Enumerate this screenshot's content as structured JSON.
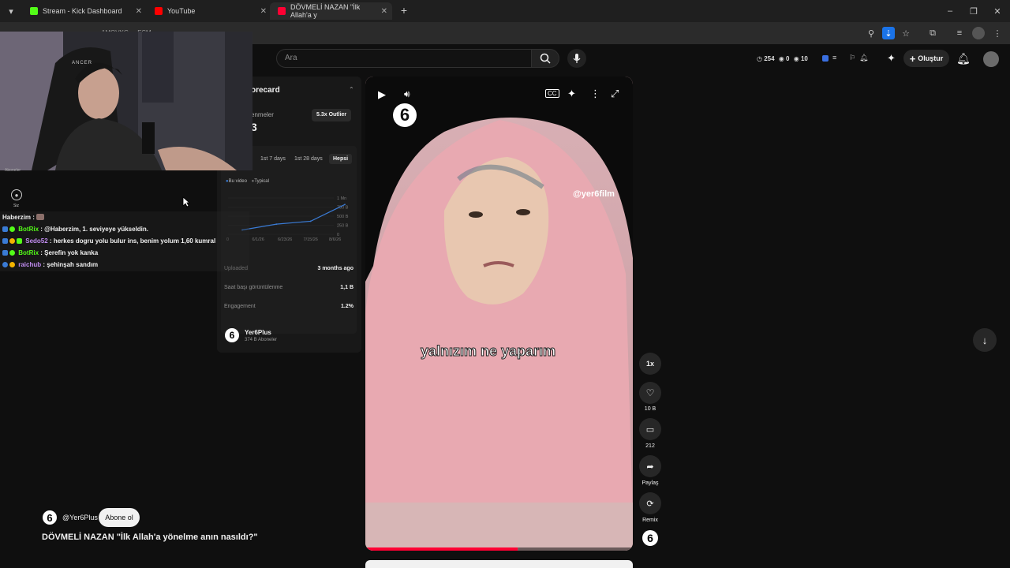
{
  "browser": {
    "tabs": [
      {
        "title": "Stream - Kick Dashboard",
        "favicon_color": "#53fc18"
      },
      {
        "title": "YouTube",
        "favicon_color": "#ff0000"
      },
      {
        "title": "DÖVMELİ NAZAN \"İlk Allah'a y",
        "favicon_color": "#ff0033"
      }
    ],
    "new_tab": "+",
    "address_fragment": "... 1MOVKG ... ESM"
  },
  "youtube": {
    "search_placeholder": "Ara",
    "stats": {
      "time": "254",
      "views": "0",
      "eyes": "10"
    },
    "create_label": "Oluştur"
  },
  "webcam": {
    "caption": "Aboneler",
    "you_label": "Siz",
    "chair_brand": "ANCER"
  },
  "chat": {
    "messages": [
      {
        "user": "Haberzim",
        "text": "",
        "color": "#f1f1f1",
        "badges": []
      },
      {
        "user": "BotRix",
        "text": "@Haberzim, 1. seviyeye yükseldin.",
        "color": "#53fc18",
        "badges": [
          "#3a7bd5",
          "#53fc18"
        ]
      },
      {
        "user": "Sedo52",
        "text": "herkes dogru yolu bulur ins, benim yolum 1,60 kumral",
        "color": "#c08cf0",
        "badges": [
          "#3a7bd5",
          "#f4b400",
          "#53fc18"
        ]
      },
      {
        "user": "BotRix",
        "text": "Şerefin yok kanka",
        "color": "#53fc18",
        "badges": [
          "#3a7bd5",
          "#53fc18"
        ]
      },
      {
        "user": "raichub",
        "text": "şehinşah sandım",
        "color": "#c08cf0",
        "badges": [
          "#3a7bd5",
          "#f4b400"
        ]
      }
    ]
  },
  "panel": {
    "title_fragment": "orecard",
    "views_label_fragment": "enmeler",
    "views_value_fragment": "3",
    "outlier_badge": "5.3x Outlier",
    "ranges": [
      "1st 7 days",
      "1st 28 days",
      "Hepsi"
    ],
    "legend": [
      "Bu video",
      "Typical"
    ],
    "y_ticks": [
      "1 Mn",
      "750 B",
      "500 B",
      "250 B",
      "0"
    ],
    "x_ticks": [
      "0",
      "6/1/26",
      "6/23/26",
      "7/15/26",
      "8/6/26"
    ],
    "rows": [
      {
        "label": "Uploaded",
        "value": "3 months ago"
      },
      {
        "label": "Saat başı görüntülenme",
        "value": "1,1 B"
      },
      {
        "label": "Engagement",
        "value": "1.2%"
      }
    ],
    "channel_name": "Yer6Plus",
    "channel_subs": "374 B Aboneler"
  },
  "chart_data": {
    "type": "line",
    "x": [
      "6/1/26",
      "6/23/26",
      "7/15/26",
      "8/6/26"
    ],
    "series": [
      {
        "name": "Bu video",
        "values": [
          120000,
          280000,
          360000,
          820000
        ]
      }
    ],
    "ylim": [
      0,
      1000000
    ],
    "y_ticks": [
      "1 Mn",
      "750 B",
      "500 B",
      "250 B",
      "0"
    ],
    "legend_position": "top-left"
  },
  "video": {
    "watermark": "@yer6film",
    "subtitle": "yalnızım ne yaparım",
    "logo": "6",
    "progress": 0.57
  },
  "actions": {
    "speed": "1x",
    "likes": "10 B",
    "comments": "212",
    "share": "Paylaş",
    "remix": "Remix"
  },
  "bottom": {
    "channel_handle": "@Yer6Plus",
    "subscribe": "Abone ol",
    "title": "DÖVMELİ NAZAN \"İlk Allah'a yönelme anın nasıldı?\""
  }
}
